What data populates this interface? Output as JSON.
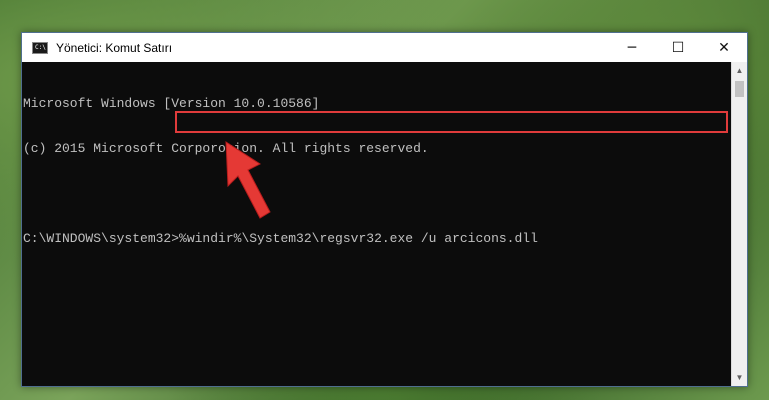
{
  "window": {
    "title": "Yönetici: Komut Satırı",
    "icon_glyph": "C:\\",
    "controls": {
      "minimize_icon": "minimize-icon",
      "maximize_icon": "maximize-icon",
      "close_icon": "close-icon",
      "minimize": "─",
      "maximize": "☐",
      "close": "✕"
    }
  },
  "console": {
    "lines": [
      "Microsoft Windows [Version 10.0.10586]",
      "(c) 2015 Microsoft Corporotion. All rights reserved.",
      "",
      "C:\\WINDOWS\\system32>%windir%\\System32\\regsvr32.exe /u arcicons.dll"
    ],
    "prompt": "C:\\WINDOWS\\system32>",
    "command": "%windir%\\System32\\regsvr32.exe /u arcicons.dll"
  },
  "annotation": {
    "highlight_color": "#e03b3b",
    "arrow_icon": "red-arrow-icon"
  },
  "scrollbar": {
    "up_glyph": "▲",
    "down_glyph": "▼"
  }
}
